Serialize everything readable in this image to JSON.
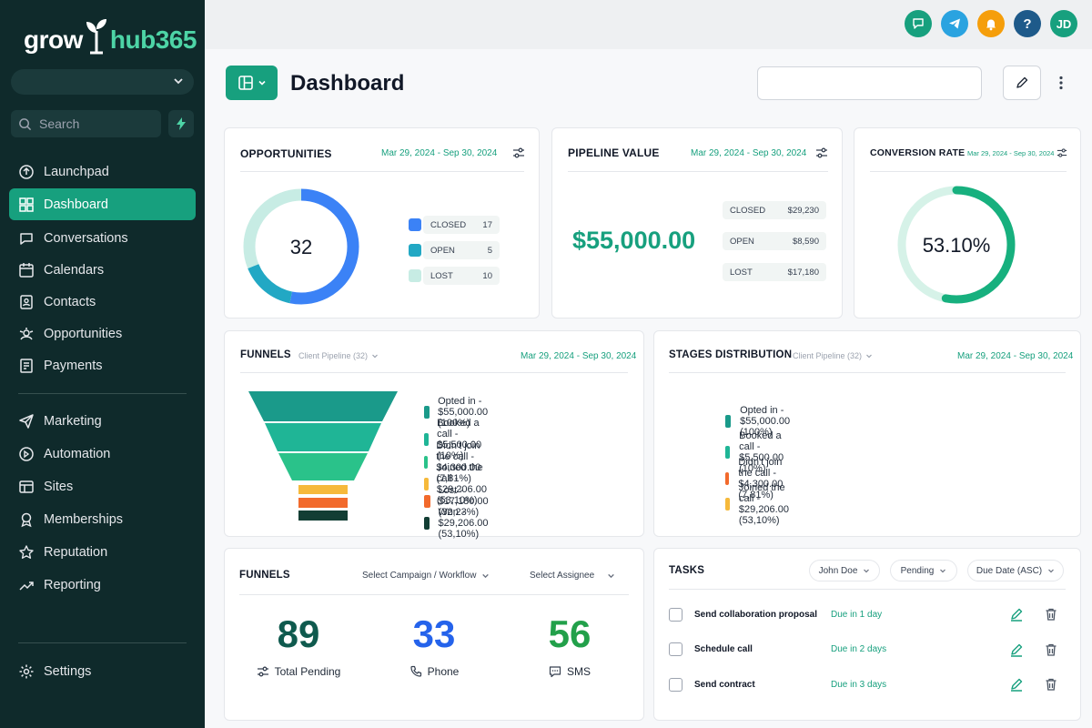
{
  "brand": {
    "name_left": "grow",
    "name_right": "hub365"
  },
  "sidebar": {
    "search_placeholder": "Search",
    "items_top": [
      {
        "label": "Launchpad",
        "icon": "launchpad-icon"
      },
      {
        "label": "Dashboard",
        "icon": "dashboard-icon",
        "active": true
      },
      {
        "label": "Conversations",
        "icon": "chat-icon"
      },
      {
        "label": "Calendars",
        "icon": "calendar-icon"
      },
      {
        "label": "Contacts",
        "icon": "contacts-icon"
      },
      {
        "label": "Opportunities",
        "icon": "opportunities-icon"
      },
      {
        "label": "Payments",
        "icon": "payments-icon"
      }
    ],
    "items_bottom": [
      {
        "label": "Marketing",
        "icon": "send-icon"
      },
      {
        "label": "Automation",
        "icon": "automation-icon"
      },
      {
        "label": "Sites",
        "icon": "sites-icon"
      },
      {
        "label": "Memberships",
        "icon": "award-icon"
      },
      {
        "label": "Reputation",
        "icon": "star-icon"
      },
      {
        "label": "Reporting",
        "icon": "trend-icon"
      }
    ],
    "settings_label": "Settings"
  },
  "topbar": {
    "icons": [
      {
        "name": "chat-icon",
        "color": "#17a07e"
      },
      {
        "name": "telegram-icon",
        "color": "#2aa3e0"
      },
      {
        "name": "bell-icon",
        "color": "#f59e0b"
      },
      {
        "name": "help-icon",
        "color": "#1e5a8a"
      }
    ],
    "avatar_initials": "JD",
    "avatar_color": "#17a07e"
  },
  "page": {
    "title": "Dashboard"
  },
  "opportunities": {
    "title": "OPPORTUNITIES",
    "date": "Mar 29, 2024 - Sep 30, 2024",
    "total": "32",
    "legend": [
      {
        "label": "CLOSED",
        "value": "17",
        "color": "#3b82f6"
      },
      {
        "label": "OPEN",
        "value": "5",
        "color": "#22a8c4"
      },
      {
        "label": "LOST",
        "value": "10",
        "color": "#c7ece4"
      }
    ]
  },
  "pipeline": {
    "title": "PIPELINE VALUE",
    "date": "Mar 29, 2024 - Sep 30, 2024",
    "total": "$55,000.00",
    "rows": [
      {
        "label": "CLOSED",
        "value": "$29,230"
      },
      {
        "label": "OPEN",
        "value": "$8,590"
      },
      {
        "label": "LOST",
        "value": "$17,180"
      }
    ]
  },
  "conversion": {
    "title": "CONVERSION RATE",
    "date": "Mar 29, 2024 - Sep 30, 2024",
    "value_text": "53.10%",
    "fraction": 0.531,
    "color": "#17b07e",
    "track_color": "#d6f2e8"
  },
  "funnels": {
    "title": "FUNNELS",
    "pipeline_select": "Client Pipeline (32)",
    "date": "Mar 29, 2024 - Sep 30, 2024",
    "stages": [
      {
        "label": "Opted in - $55,000.00 (100%)",
        "color": "#1a9a8a"
      },
      {
        "label": "Booked a call - $5,500.00 (10%)",
        "color": "#1fb596"
      },
      {
        "label": "Didn't join the call - $4,300.00 (7,81%)",
        "color": "#2ac28a"
      },
      {
        "label": "Joined the call - $29,206.00 (53,10%)",
        "color": "#f6b93b"
      },
      {
        "label": "Lost - $17,180.00 (32,23%)",
        "color": "#f26a2c"
      },
      {
        "label": "Won - $29,206.00 (53,10%)",
        "color": "#123e34"
      }
    ]
  },
  "stages": {
    "title": "STAGES DISTRIBUTION",
    "pipeline_select": "Client Pipeline (32)",
    "date": "Mar 29, 2024 - Sep 30, 2024",
    "items": [
      {
        "label": "Opted in - $55,000.00 (100%)",
        "color": "#1a9a8a"
      },
      {
        "label": "Booked a call - $5,500.00 (10%)",
        "color": "#1fb596"
      },
      {
        "label": "Didn't join the call - $4,300.00 (7,81%)",
        "color": "#f26a2c"
      },
      {
        "label": "Joined the call - $29,206.00 (53,10%)",
        "color": "#f6b93b"
      }
    ]
  },
  "funnels2": {
    "title": "FUNNELS",
    "campaign_select": "Select Campaign / Workflow",
    "assignee_select": "Select Assignee",
    "stats": [
      {
        "value": "89",
        "label": "Total Pending",
        "color": "#0f5a4e",
        "icon": "sliders-icon"
      },
      {
        "value": "33",
        "label": "Phone",
        "color": "#2563eb",
        "icon": "phone-icon"
      },
      {
        "value": "56",
        "label": "SMS",
        "color": "#22a04a",
        "icon": "sms-icon"
      }
    ]
  },
  "tasks": {
    "title": "TASKS",
    "filters": [
      "John Doe",
      "Pending",
      "Due Date (ASC)"
    ],
    "rows": [
      {
        "name": "Send collaboration proposal",
        "due": "Due in 1 day"
      },
      {
        "name": "Schedule call",
        "due": "Due in 2 days"
      },
      {
        "name": "Send contract",
        "due": "Due in 3 days"
      }
    ]
  }
}
